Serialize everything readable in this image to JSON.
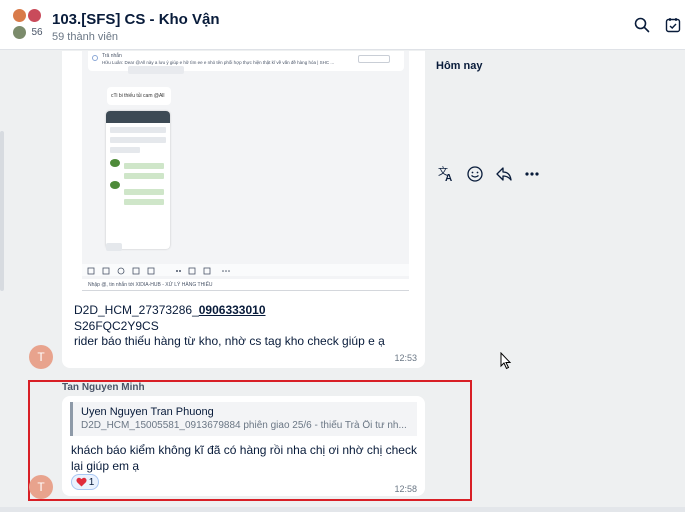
{
  "header": {
    "title": "103.[SFS] CS - Kho Vận",
    "member_count": "56",
    "members_label": "59 thành viên",
    "search_icon": "search-icon",
    "calendar_icon": "calendar-check-icon"
  },
  "screenshot_embed": {
    "reply_label": "Trả nhắn",
    "reply_text": "Hữu Luân: Dear @All này a lưu ý giúp e  hữ tìm ee e nhỏ tên phối hợp thực hiện thật kĩ về vấn đề hàng hóa | SHC ...",
    "hom_nay": "Hôm nay",
    "small_msg": "cTi bi thiếu tủi cam @All",
    "input_placeholder": "Nhập @, tin nhắn tới XIDIA-HUB - XỬ LÝ HÀNG THIẾU"
  },
  "message1": {
    "line1_prefix": "D2D_HCM_27373286_",
    "line1_phone": "0906333010",
    "line2": "S26FQC2Y9CS",
    "line3": "rider báo thiếu hàng từ kho, nhờ cs tag kho check giúp e ạ",
    "time": "12:53",
    "avatar_letter": "T"
  },
  "reactions": {
    "translate_icon": "translate-icon",
    "emoji_icon": "smile-icon",
    "reply_icon": "reply-icon",
    "more_icon": "more-icon"
  },
  "message2": {
    "sender": "Tan Nguyen Minh",
    "quote_name": "Uyen Nguyen Tran Phuong",
    "quote_text": "D2D_HCM_15005581_0913679884 phiên giao 25/6 - thiếu Trà Ổi tư nh...",
    "line1": "khách báo kiểm không kĩ đã có hàng rồi nha chị ơi nhờ chị check",
    "line2": "lại giúp em ạ",
    "reaction_count": "1",
    "time": "12:58",
    "avatar_letter": "T"
  },
  "colors": {
    "highlight": "#d81f26",
    "text": "#081b3a",
    "avatar": "#e8a38d"
  }
}
